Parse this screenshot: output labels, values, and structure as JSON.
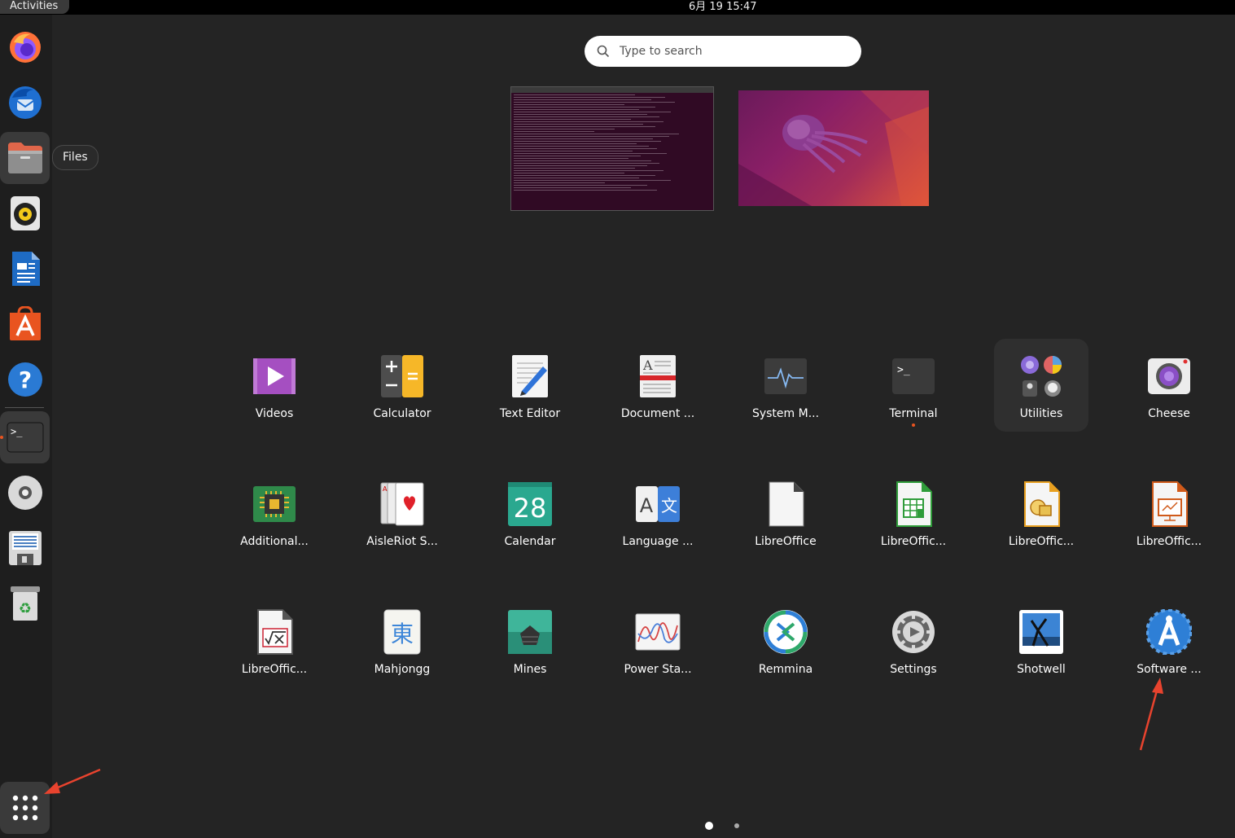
{
  "topbar": {
    "activities": "Activities",
    "clock": "6月 19  15:47"
  },
  "dock": {
    "tooltip": "Files",
    "items": [
      "firefox-icon",
      "thunderbird-icon",
      "files-icon",
      "rhythmbox-icon",
      "writer-icon",
      "app-center-icon",
      "help-icon",
      "terminal-icon",
      "disc-icon",
      "floppy-icon",
      "trash-icon"
    ],
    "show_apps_label": "Show Applications"
  },
  "search": {
    "placeholder": "Type to search"
  },
  "apps": [
    {
      "label": "Videos"
    },
    {
      "label": "Calculator"
    },
    {
      "label": "Text Editor"
    },
    {
      "label": "Document ..."
    },
    {
      "label": "System M..."
    },
    {
      "label": "Terminal"
    },
    {
      "label": "Utilities"
    },
    {
      "label": "Cheese"
    },
    {
      "label": "Additional..."
    },
    {
      "label": "AisleRiot S..."
    },
    {
      "label": "Calendar"
    },
    {
      "label": "Language ..."
    },
    {
      "label": "LibreOffice"
    },
    {
      "label": "LibreOffic..."
    },
    {
      "label": "LibreOffic..."
    },
    {
      "label": "LibreOffic..."
    },
    {
      "label": "LibreOffic..."
    },
    {
      "label": "Mahjongg"
    },
    {
      "label": "Mines"
    },
    {
      "label": "Power Sta..."
    },
    {
      "label": "Remmina"
    },
    {
      "label": "Settings"
    },
    {
      "label": "Shotwell"
    },
    {
      "label": "Software ..."
    }
  ],
  "calendar_day": "28",
  "mahjongg_glyph": "東",
  "language_glyphs": {
    "latin": "A",
    "cjk": "文"
  },
  "pages": {
    "current": 1,
    "total": 2
  },
  "colors": {
    "accent": "#e95420",
    "annotation": "#e8432e"
  }
}
